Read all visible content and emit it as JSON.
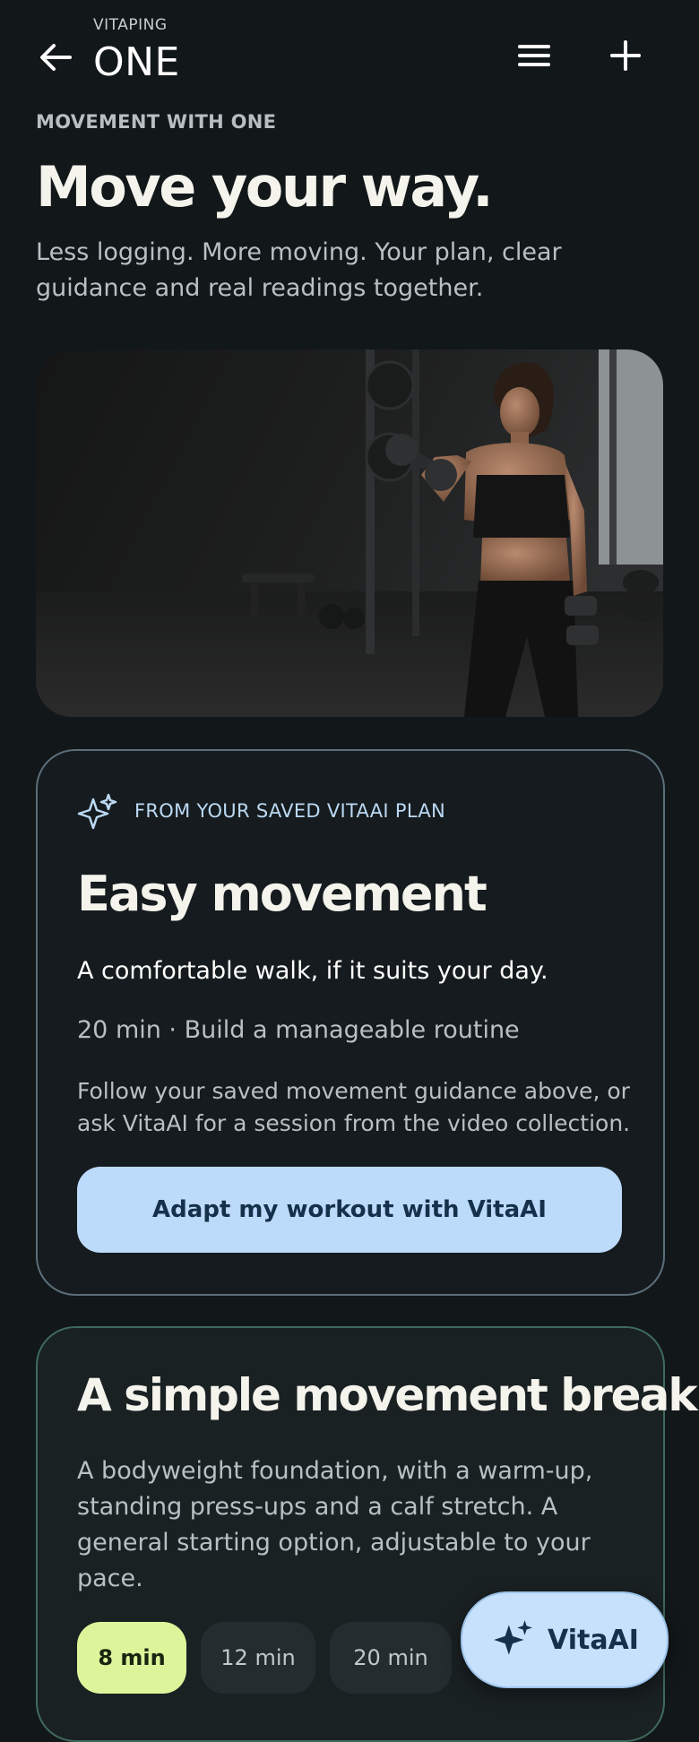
{
  "header": {
    "brand_small": "VITAPING",
    "brand_big": "ONE",
    "back_icon": "arrow-left-icon",
    "menu_icon": "menu-icon",
    "add_icon": "plus-icon"
  },
  "hero": {
    "eyebrow": "MOVEMENT WITH ONE",
    "title": "Move your way.",
    "subtitle": "Less logging. More moving. Your plan, clear guidance and real readings together."
  },
  "plan_card": {
    "icon": "sparkle-icon",
    "eyebrow": "FROM YOUR SAVED VITAAI PLAN",
    "title": "Easy movement",
    "line1": "A comfortable walk, if it suits your day.",
    "line2": "20 min · Build a manageable routine",
    "body": "Follow your saved movement guidance above, or ask VitaAI for a session from the video collection.",
    "button_label": "Adapt my workout with VitaAI"
  },
  "break_card": {
    "title": "A simple movement break",
    "body": "A bodyweight foundation, with a warm-up, standing press-ups and a calf stretch. A general starting option, adjustable to your pace.",
    "durations": [
      "8 min",
      "12 min",
      "20 min"
    ],
    "selected_duration": "8 min"
  },
  "fab": {
    "icon": "sparkle-icon",
    "label": "VitaAI"
  },
  "colors": {
    "background": "#121719",
    "accent_blue": "#bcdafa",
    "accent_green": "#dcf59a"
  }
}
